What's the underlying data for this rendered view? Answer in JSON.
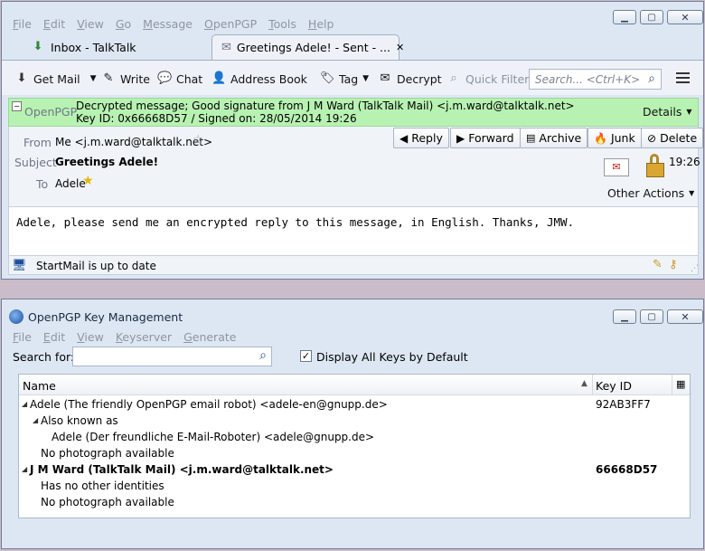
{
  "mail": {
    "menu": [
      "File",
      "Edit",
      "View",
      "Go",
      "Message",
      "OpenPGP",
      "Tools",
      "Help"
    ],
    "tabs": [
      {
        "label": "Inbox - TalkTalk",
        "icon": "download-inbox-icon"
      },
      {
        "label": "Greetings Adele! - Sent - ...",
        "icon": "envelope-icon"
      }
    ],
    "toolbar": {
      "get_mail": "Get Mail",
      "write": "Write",
      "chat": "Chat",
      "address_book": "Address Book",
      "tag": "Tag",
      "decrypt": "Decrypt",
      "quick_filter": "Quick Filter",
      "search_placeholder": "Search... <Ctrl+K>"
    },
    "openpgp": {
      "label": "OpenPGP",
      "line1": "Decrypted message; Good signature from J M Ward (TalkTalk Mail) <j.m.ward@talktalk.net>",
      "line2": "Key ID: 0x66668D57 / Signed on: 28/05/2014 19:26",
      "details": "Details"
    },
    "header": {
      "from_label": "From",
      "from_value": "Me <j.m.ward@talktalk.net>",
      "subject_label": "Subject",
      "subject_value": "Greetings Adele!",
      "to_label": "To",
      "to_value": "Adele",
      "time": "19:26",
      "other_actions": "Other Actions"
    },
    "actions": {
      "reply": "Reply",
      "forward": "Forward",
      "archive": "Archive",
      "junk": "Junk",
      "delete": "Delete"
    },
    "body": "Adele, please send me an encrypted reply to this message, in English.  Thanks, JMW.",
    "status": "StartMail is up to date"
  },
  "keymgr": {
    "title": "OpenPGP Key Management",
    "menu": [
      "File",
      "Edit",
      "View",
      "Keyserver",
      "Generate"
    ],
    "search_label": "Search for:",
    "display_all": "Display All Keys by Default",
    "columns": {
      "name": "Name",
      "keyid": "Key ID"
    },
    "rows": [
      {
        "text": "Adele (The friendly OpenPGP email robot) <adele-en@gnupp.de>",
        "keyid": "92AB3FF7",
        "level": 0,
        "bold": false,
        "expander": true
      },
      {
        "text": "Also known as",
        "keyid": "",
        "level": 1,
        "bold": false,
        "expander": true
      },
      {
        "text": "Adele (Der freundliche E-Mail-Roboter) <adele@gnupp.de>",
        "keyid": "",
        "level": 2,
        "bold": false,
        "expander": false
      },
      {
        "text": "No photograph available",
        "keyid": "",
        "level": 1,
        "bold": false,
        "expander": false
      },
      {
        "text": "J M Ward (TalkTalk Mail) <j.m.ward@talktalk.net>",
        "keyid": "66668D57",
        "level": 0,
        "bold": true,
        "expander": true
      },
      {
        "text": "Has no other identities",
        "keyid": "",
        "level": 1,
        "bold": false,
        "expander": false
      },
      {
        "text": "No photograph available",
        "keyid": "",
        "level": 1,
        "bold": false,
        "expander": false
      }
    ]
  }
}
